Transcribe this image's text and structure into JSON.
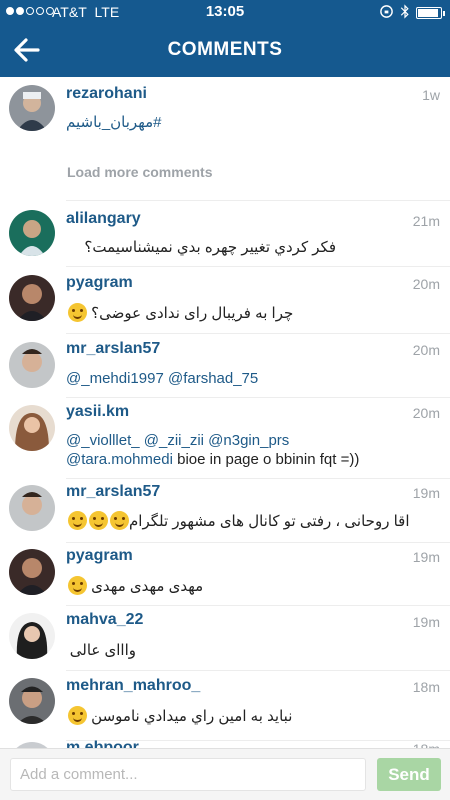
{
  "status": {
    "carrier": "AT&T",
    "network": "LTE",
    "time": "13:05"
  },
  "nav": {
    "title": "COMMENTS"
  },
  "post": {
    "username": "rezarohani",
    "time": "1w",
    "caption": "#مهربان_باشیم"
  },
  "load_more": "Load more comments",
  "comments": [
    {
      "username": "alilangary",
      "time": "21m",
      "text": "فکر کردي تغيير چهره بدي نميشناسيمت؟"
    },
    {
      "username": "pyagram",
      "time": "20m",
      "text": "چرا به فریبال رای ندادی عوضی؟"
    },
    {
      "username": "mr_arslan57",
      "time": "20m",
      "text": "@_mehdi1997 @farshad_75"
    },
    {
      "username": "yasii.km",
      "time": "20m",
      "line1": "@_violllet_ @_zii_zii @n3gin_prs",
      "line2_mention": "@tara.mohmedi",
      "line2_text": "bioe in page o bbinin fqt =))"
    },
    {
      "username": "mr_arslan57",
      "time": "19m",
      "text": "اقا روحانی ، رفتی تو کانال های مشهور تلگرام"
    },
    {
      "username": "pyagram",
      "time": "19m",
      "text": "مهدی مهدی مهدی"
    },
    {
      "username": "mahva_22",
      "time": "19m",
      "text": "وااای عالی"
    },
    {
      "username": "mehran_mahroo_",
      "time": "18m",
      "text": "نباید به امین راي میدادي ناموسن"
    },
    {
      "username": "m.ebpoor",
      "time": "18m"
    }
  ],
  "composer": {
    "placeholder": "Add a comment...",
    "send_label": "Send"
  },
  "colors": {
    "nav_bg": "#15598f",
    "username": "#1e5a88",
    "send_bg": "#a9d6a4"
  }
}
